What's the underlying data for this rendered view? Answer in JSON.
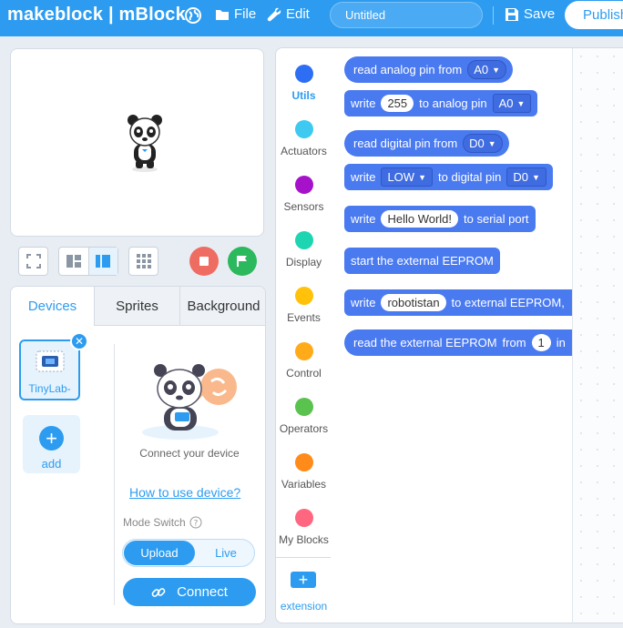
{
  "topbar": {
    "logo": "makeblock | mBlock",
    "menu_file": "File",
    "menu_edit": "Edit",
    "project_title": "Untitled",
    "save": "Save",
    "publish": "Publish"
  },
  "colors": {
    "brand": "#2d9cf0",
    "block_blue": "#4a7af0",
    "stop": "#ef6c62",
    "go": "#2cb85c"
  },
  "device_panel": {
    "tabs": [
      {
        "label": "Devices",
        "active": true
      },
      {
        "label": "Sprites",
        "active": false
      },
      {
        "label": "Background",
        "active": false
      }
    ],
    "device_name": "TinyLab-",
    "add_label": "add",
    "connect_text": "Connect your device",
    "how_to": "How to use device?",
    "mode_switch": "Mode Switch",
    "mode_upload": "Upload",
    "mode_live": "Live",
    "connect_button": "Connect"
  },
  "categories": [
    {
      "label": "Utils",
      "color": "#2e6ef5",
      "active": true
    },
    {
      "label": "Actuators",
      "color": "#3ec9f1"
    },
    {
      "label": "Sensors",
      "color": "#a612c9"
    },
    {
      "label": "Display",
      "color": "#1ed5b1"
    },
    {
      "label": "Events",
      "color": "#ffc10a"
    },
    {
      "label": "Control",
      "color": "#ffab19"
    },
    {
      "label": "Operators",
      "color": "#5ac24e"
    },
    {
      "label": "Variables",
      "color": "#ff8c1a"
    },
    {
      "label": "My Blocks",
      "color": "#ff6680"
    }
  ],
  "extension_label": "extension",
  "blocks": {
    "b1": {
      "text": "read analog pin from",
      "dd": "A0"
    },
    "b2": {
      "t1": "write",
      "val": "255",
      "t2": "to analog pin",
      "dd": "A0"
    },
    "b3": {
      "text": "read digital pin from",
      "dd": "D0"
    },
    "b4": {
      "t1": "write",
      "dd1": "LOW",
      "t2": "to digital pin",
      "dd2": "D0"
    },
    "b5": {
      "t1": "write",
      "val": "Hello World!",
      "t2": "to serial port"
    },
    "b6": {
      "text": "start the external EEPROM"
    },
    "b7": {
      "t1": "write",
      "val": "robotistan",
      "t2": "to external EEPROM,"
    },
    "b8": {
      "t1": "read the external EEPROM",
      "t2": "from",
      "val": "1",
      "t3": "in"
    }
  }
}
